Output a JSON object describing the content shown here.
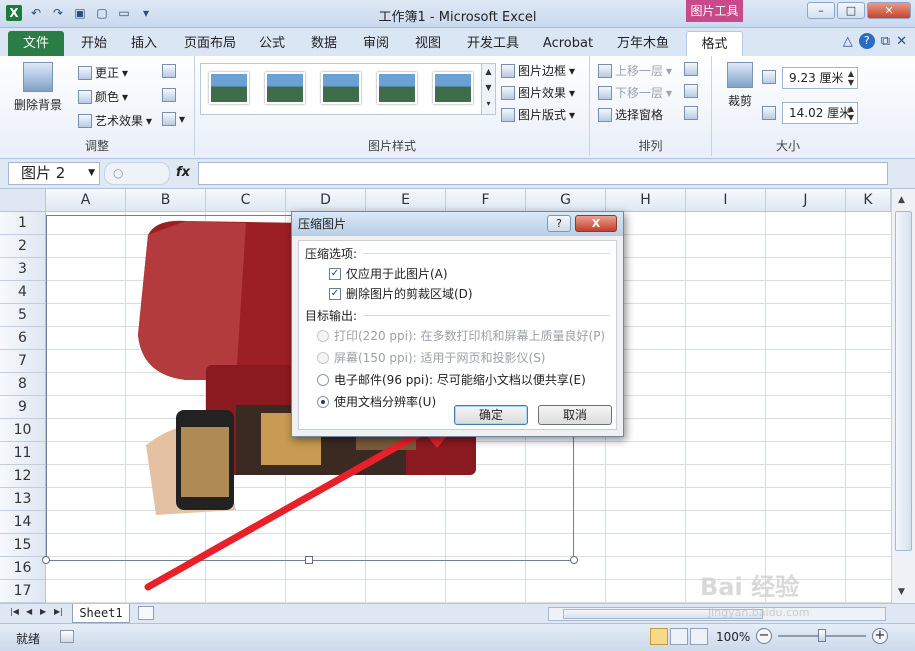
{
  "window": {
    "title": "工作簿1 - Microsoft Excel",
    "context_tab": "图片工具"
  },
  "ribbon_tabs": [
    "文件",
    "开始",
    "插入",
    "页面布局",
    "公式",
    "数据",
    "审阅",
    "视图",
    "开发工具",
    "Acrobat",
    "万年木鱼",
    "格式"
  ],
  "active_tab": "格式",
  "ribbon": {
    "adjust": {
      "remove_bg": "删除背景",
      "corrections": "更正",
      "color": "颜色",
      "artistic": "艺术效果",
      "label": "调整"
    },
    "styles": {
      "border": "图片边框",
      "effects": "图片效果",
      "layout": "图片版式",
      "label": "图片样式"
    },
    "arrange": {
      "bring_forward": "上移一层",
      "send_backward": "下移一层",
      "selection_pane": "选择窗格",
      "label": "排列"
    },
    "size": {
      "crop": "裁剪",
      "height": "9.23 厘米",
      "width": "14.02 厘米",
      "label": "大小"
    }
  },
  "formula_bar": {
    "name_box": "图片 2",
    "fx": "fx",
    "value": ""
  },
  "columns": [
    "A",
    "B",
    "C",
    "D",
    "E",
    "F",
    "G",
    "H",
    "I",
    "J",
    "K"
  ],
  "rows": [
    "1",
    "2",
    "3",
    "4",
    "5",
    "6",
    "7",
    "8",
    "9",
    "10",
    "11",
    "12",
    "13",
    "14",
    "15",
    "16",
    "17"
  ],
  "dialog": {
    "title": "压缩图片",
    "help": "?",
    "close": "X",
    "compress_section": "压缩选项:",
    "opt_apply_only": "仅应用于此图片(A)",
    "opt_delete_crop": "删除图片的剪裁区域(D)",
    "target_section": "目标输出:",
    "print": "打印(220 ppi): 在多数打印机和屏幕上质量良好(P)",
    "screen": "屏幕(150 ppi): 适用于网页和投影仪(S)",
    "email": "电子邮件(96 ppi): 尽可能缩小文档以便共享(E)",
    "document": "使用文档分辨率(U)",
    "ok": "确定",
    "cancel": "取消",
    "apply_only_checked": true,
    "delete_crop_checked": true,
    "selected_target": "document"
  },
  "sheet_tab": "Sheet1",
  "status": {
    "ready": "就绪",
    "zoom": "100%"
  },
  "watermark": {
    "brand": "Bai 经验",
    "url": "jingyan.baidu.com"
  },
  "colors": {
    "file_tab": "#2a7d45",
    "context_tab": "#c94a8a",
    "arrow": "#e8202a",
    "printer": "#9b1f24"
  }
}
